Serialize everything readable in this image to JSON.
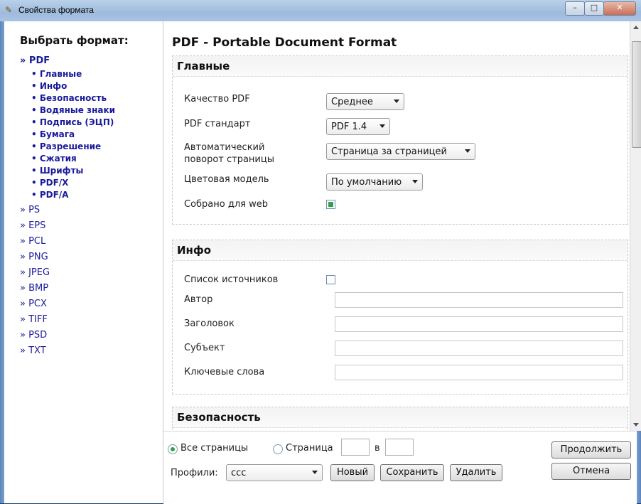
{
  "window": {
    "title": "Свойства формата",
    "app_icon": "properties-icon",
    "minimize": "–",
    "maximize": "□",
    "close": "✕"
  },
  "nav": {
    "heading": "Выбрать формат:",
    "current_format": "» PDF",
    "sub_items": [
      "• Главные",
      "• Инфо",
      "• Безопасность",
      "• Водяные знаки",
      "• Подпись (ЭЦП)",
      "• Бумага",
      "• Разрешение",
      "• Сжатия",
      "• Шрифты",
      "• PDF/X",
      "• PDF/A"
    ],
    "formats": [
      "» PS",
      "» EPS",
      "» PCL",
      "» PNG",
      "» JPEG",
      "» BMP",
      "» PCX",
      "» TIFF",
      "» PSD",
      "» TXT"
    ]
  },
  "main": {
    "page_title": "PDF - Portable Document Format",
    "general": {
      "title": "Главные",
      "quality_label": "Качество PDF",
      "quality_value": "Среднее",
      "standard_label": "PDF стандарт",
      "standard_value": "PDF 1.4",
      "rotate_label_1": "Автоматический",
      "rotate_label_2": "поворот страницы",
      "rotate_value": "Страница за страницей",
      "color_label": "Цветовая модель",
      "color_value": "По умолчанию",
      "web_label": "Собрано для web",
      "web_checked": true
    },
    "info": {
      "title": "Инфо",
      "sources_label": "Список источников",
      "sources_checked": false,
      "author_label": "Автор",
      "author_value": "",
      "title_label": "Заголовок",
      "title_value": "",
      "subject_label": "Субъект",
      "subject_value": "",
      "keywords_label": "Ключевые слова",
      "keywords_value": ""
    },
    "security": {
      "title": "Безопасность"
    }
  },
  "bottom": {
    "all_pages_label": "Все страницы",
    "all_pages_selected": true,
    "page_label": "Страница",
    "page_from": "",
    "in_label": "в",
    "page_to": "",
    "profiles_label": "Профили:",
    "profile_value": "ccc",
    "new_button": "Новый",
    "save_button": "Сохранить",
    "delete_button": "Удалить",
    "continue_button": "Продолжить",
    "cancel_button": "Отмена"
  },
  "colors": {
    "nav_link": "#1a1a9a",
    "check_green": "#2ea34a",
    "title_bar": "#b9d1ea"
  }
}
